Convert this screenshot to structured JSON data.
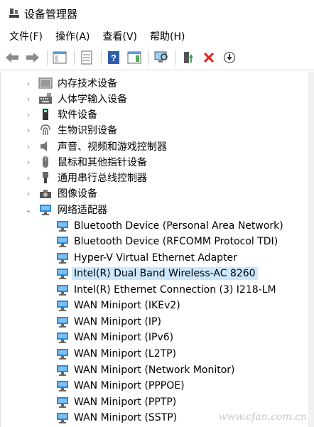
{
  "window": {
    "title": "设备管理器"
  },
  "menu": [
    {
      "label": "文件(F)"
    },
    {
      "label": "操作(A)"
    },
    {
      "label": "查看(V)"
    },
    {
      "label": "帮助(H)"
    }
  ],
  "toolbar": [
    {
      "icon": "back-arrow-icon"
    },
    {
      "icon": "forward-arrow-icon"
    },
    {
      "icon": "show-hide-console-tree-icon"
    },
    {
      "icon": "properties-icon"
    },
    {
      "icon": "help-icon"
    },
    {
      "icon": "action-pane-icon"
    },
    {
      "icon": "scan-hardware-icon"
    },
    {
      "icon": "update-driver-icon"
    },
    {
      "icon": "uninstall-device-icon"
    },
    {
      "icon": "download-icon"
    }
  ],
  "tree": {
    "categories": [
      {
        "label": "内存技术设备",
        "icon": "memory-device-icon",
        "expanded": false
      },
      {
        "label": "人体学输入设备",
        "icon": "keyboard-icon",
        "expanded": false
      },
      {
        "label": "软件设备",
        "icon": "software-device-icon",
        "expanded": false
      },
      {
        "label": "生物识别设备",
        "icon": "fingerprint-icon",
        "expanded": false
      },
      {
        "label": "声音、视频和游戏控制器",
        "icon": "speaker-icon",
        "expanded": false
      },
      {
        "label": "鼠标和其他指针设备",
        "icon": "mouse-icon",
        "expanded": false
      },
      {
        "label": "通用串行总线控制器",
        "icon": "usb-icon",
        "expanded": false
      },
      {
        "label": "图像设备",
        "icon": "camera-icon",
        "expanded": false
      },
      {
        "label": "网络适配器",
        "icon": "network-adapter-icon",
        "expanded": true
      }
    ],
    "network_adapters": [
      {
        "label": "Bluetooth Device (Personal Area Network)"
      },
      {
        "label": "Bluetooth Device (RFCOMM Protocol TDI)"
      },
      {
        "label": "Hyper-V Virtual Ethernet Adapter"
      },
      {
        "label": "Intel(R) Dual Band Wireless-AC 8260",
        "selected": true
      },
      {
        "label": "Intel(R) Ethernet Connection (3) I218-LM"
      },
      {
        "label": "WAN Miniport (IKEv2)"
      },
      {
        "label": "WAN Miniport (IP)"
      },
      {
        "label": "WAN Miniport (IPv6)"
      },
      {
        "label": "WAN Miniport (L2TP)"
      },
      {
        "label": "WAN Miniport (Network Monitor)"
      },
      {
        "label": "WAN Miniport (PPPOE)"
      },
      {
        "label": "WAN Miniport (PPTP)"
      },
      {
        "label": "WAN Miniport (SSTP)"
      }
    ]
  },
  "watermark": "www.cfan.com.cn",
  "colors": {
    "selection": "#cce8ff",
    "network_icon": "#2b88d8"
  }
}
